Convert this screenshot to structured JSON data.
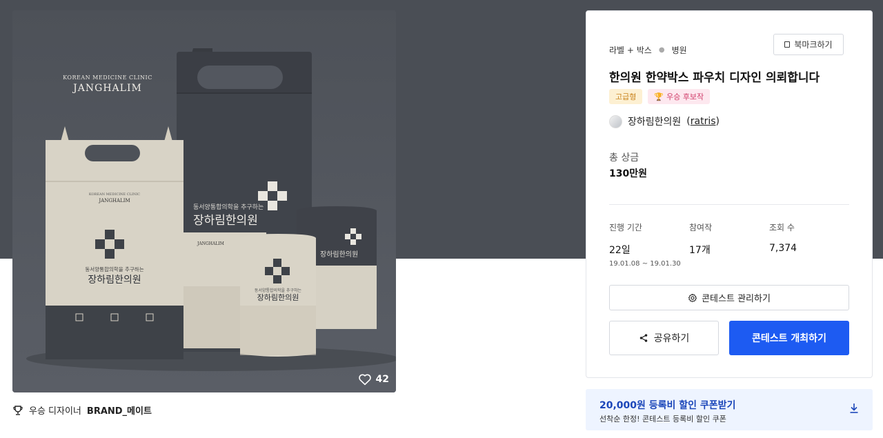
{
  "image": {
    "brand_top": "KOREAN MEDICINE CLINIC",
    "brand_name": "JANGHALIM",
    "slogan": "동서양통합의학을 추구하는",
    "clinic_name": "장하림한의원",
    "like_count": "42"
  },
  "winner": {
    "label": "우승 디자이너",
    "name": "BRAND_메이트"
  },
  "contest": {
    "category": "라벨 + 박스",
    "industry": "병원",
    "bookmark_label": "북마크하기",
    "title": "한의원 한약박스 파우치 디자인 의뢰합니다",
    "badges": [
      "고급형",
      "우승 후보작"
    ],
    "owner_name": "장하림한의원",
    "owner_id": "ratris",
    "prize_label": "총 상금",
    "prize_value": "130만원",
    "stats": [
      {
        "label": "진행 기간",
        "value": "22일",
        "sub": "19.01.08 ~ 19.01.30"
      },
      {
        "label": "참여작",
        "value": "17개",
        "sub": ""
      },
      {
        "label": "조회 수",
        "value": "7,374",
        "sub": ""
      }
    ],
    "manage_label": "콘테스트 관리하기",
    "share_label": "공유하기",
    "host_label": "콘테스트 개최하기"
  },
  "coupon": {
    "title": "20,000원 등록비 할인 쿠폰받기",
    "subtitle": "선착순 한정! 콘테스트 등록비 할인 쿠폰"
  },
  "colors": {
    "hero_bg": "#4a4e55",
    "primary": "#1d5bf2",
    "coupon_bg": "#eef4ff",
    "coupon_title": "#1b46b9"
  }
}
